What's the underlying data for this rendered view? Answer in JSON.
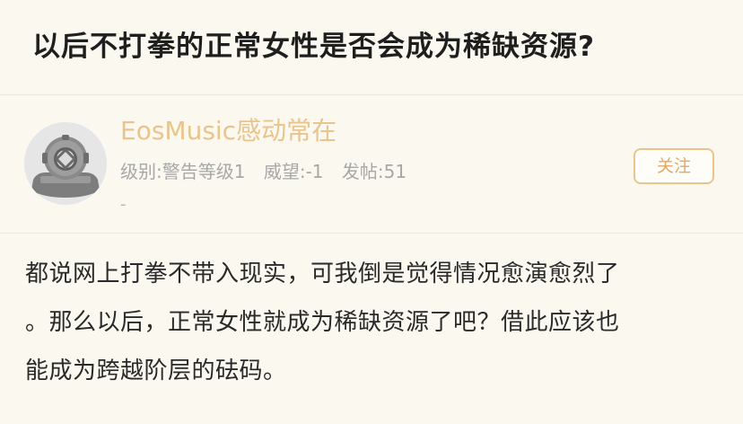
{
  "post": {
    "title": "以后不打拳的正常女性是否会成为稀缺资源?"
  },
  "author": {
    "name": "EosMusic感动常在",
    "level": "级别:警告等级1",
    "prestige": "威望:-1",
    "posts": "发帖:51",
    "signature": "-",
    "follow_label": "关注"
  },
  "content": {
    "lines": [
      "都说网上打拳不带入现实，可我倒是觉得情况愈演愈烈了",
      "。那么以后，正常女性就成为稀缺资源了吧？借此应该也",
      "能成为跨越阶层的砝码。"
    ]
  },
  "colors": {
    "background": "#fbf8f0",
    "author_name": "#e9c48d",
    "accent": "#e0a868",
    "meta_text": "#a7a7a7"
  },
  "icons": {
    "avatar": "diving-helmet-avatar"
  }
}
